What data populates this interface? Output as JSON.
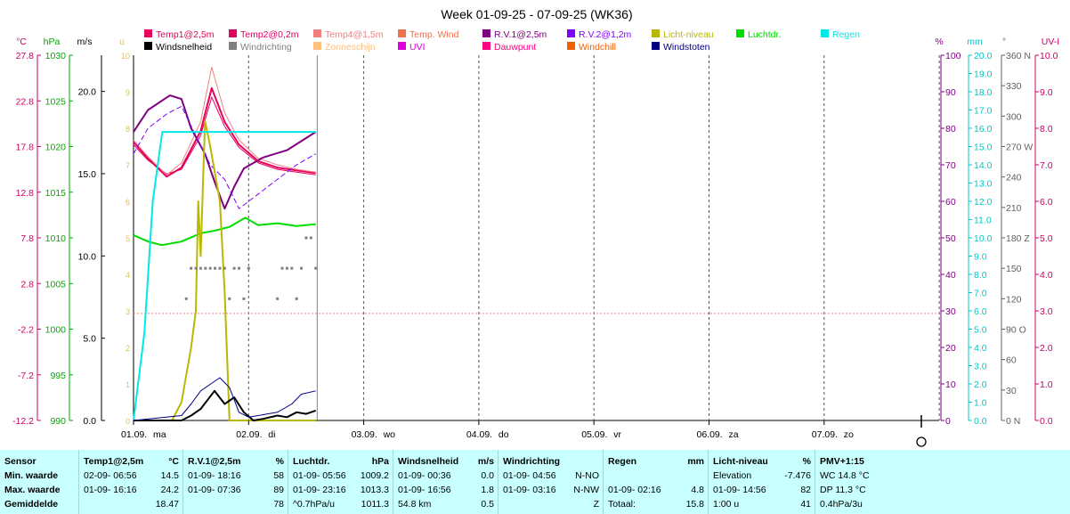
{
  "chart_data": {
    "type": "line",
    "title": "Week 01-09-25 - 07-09-25 (WK36)",
    "x_ticks": [
      {
        "date": "01.09.",
        "day": "ma"
      },
      {
        "date": "02.09.",
        "day": "di"
      },
      {
        "date": "03.09.",
        "day": "wo"
      },
      {
        "date": "04.09.",
        "day": "do"
      },
      {
        "date": "05.09.",
        "day": "vr"
      },
      {
        "date": "06.09.",
        "day": "za"
      },
      {
        "date": "07.09.",
        "day": "zo"
      }
    ],
    "axes": {
      "celsius": {
        "label": "°C",
        "ticks": [
          "27.8",
          "22.8",
          "17.8",
          "12.8",
          "7.8",
          "2.8",
          "-2.2",
          "-7.2",
          "-12.2"
        ],
        "color": "#cc0066"
      },
      "hpa": {
        "label": "hPa",
        "ticks": [
          "1030",
          "1025",
          "1020",
          "1015",
          "1010",
          "1005",
          "1000",
          "995",
          "990"
        ],
        "color": "#00aa00"
      },
      "ms": {
        "label": "m/s",
        "ticks": [
          "20.0",
          "15.0",
          "10.0",
          "5.0",
          "0.0"
        ],
        "color": "#000000"
      },
      "u": {
        "label": "u",
        "ticks": [
          "10",
          "9",
          "8",
          "7",
          "6",
          "5",
          "4",
          "3",
          "2",
          "1",
          "0"
        ],
        "color": "#e0c060"
      },
      "pct": {
        "label": "%",
        "ticks": [
          "100",
          "90",
          "80",
          "70",
          "60",
          "50",
          "40",
          "30",
          "20",
          "10",
          "0"
        ],
        "color": "#800080"
      },
      "mm": {
        "label": "mm",
        "ticks": [
          "20.0",
          "19.0",
          "18.0",
          "17.0",
          "16.0",
          "15.0",
          "14.0",
          "13.0",
          "12.0",
          "11.0",
          "10.0",
          "9.0",
          "8.0",
          "7.0",
          "6.0",
          "5.0",
          "4.0",
          "3.0",
          "2.0",
          "1.0",
          "0.0"
        ],
        "color": "#00c8c8"
      },
      "deg": {
        "label": "°",
        "ticks": [
          "360 N",
          "330",
          "300",
          "270 W",
          "240",
          "210",
          "180 Z",
          "150",
          "120",
          "90  O",
          "60",
          "30",
          "0    N"
        ],
        "color": "#606060"
      },
      "uvi": {
        "label": "UV-I",
        "ticks": [
          "10.0",
          "9.0",
          "8.0",
          "7.0",
          "6.0",
          "5.0",
          "4.0",
          "3.0",
          "2.0",
          "1.0",
          "0.0"
        ],
        "color": "#cc0066"
      }
    },
    "legend": [
      {
        "name": "Temp1@2,5m",
        "color": "#e8005a"
      },
      {
        "name": "Temp2@0,2m",
        "color": "#e00060"
      },
      {
        "name": "Temp4@1,5m",
        "color": "#f08080"
      },
      {
        "name": "Temp. Wind",
        "color": "#f07050"
      },
      {
        "name": "R.V.1@2,5m",
        "color": "#800080"
      },
      {
        "name": "R.V.2@1,2m",
        "color": "#8000ff"
      },
      {
        "name": "Licht-niveau",
        "color": "#b8b800"
      },
      {
        "name": "Luchtdr.",
        "color": "#00dd00"
      },
      {
        "name": "Regen",
        "color": "#00e8e8"
      },
      {
        "name": "Windsnelheid",
        "color": "#000000"
      },
      {
        "name": "Windrichting",
        "color": "#808080"
      },
      {
        "name": "Zonneschijn",
        "color": "#ffc080"
      },
      {
        "name": "UVI",
        "color": "#e000e0"
      },
      {
        "name": "Dauwpunt",
        "color": "#ff0080"
      },
      {
        "name": "Windchill",
        "color": "#f06000"
      },
      {
        "name": "Windstoten",
        "color": "#000080"
      }
    ],
    "series": [
      {
        "name": "Temp1@2,5m",
        "unit": "°C",
        "x_hours": [
          0,
          3,
          6.9,
          10,
          14,
          16.3,
          19,
          22,
          26,
          30,
          34,
          38
        ],
        "values": [
          18.3,
          16.5,
          14.5,
          15.5,
          19.5,
          24.2,
          20.5,
          18,
          16.2,
          15.5,
          15.2,
          14.9
        ]
      },
      {
        "name": "Temp2@0,2m",
        "unit": "°C",
        "x_hours": [
          0,
          3,
          6.9,
          10,
          14,
          16.3,
          19,
          22,
          26,
          30,
          34,
          38
        ],
        "values": [
          18,
          16.3,
          14.8,
          15.3,
          19,
          23.2,
          20,
          17.7,
          16,
          15.3,
          15,
          14.7
        ]
      },
      {
        "name": "Temp4@1,5m",
        "unit": "°C",
        "x_hours": [
          0,
          3,
          6.9,
          10,
          14,
          16.3,
          19,
          22,
          26,
          30,
          34,
          38
        ],
        "values": [
          18.5,
          16.7,
          14.7,
          16,
          20.5,
          26.5,
          21.5,
          18.5,
          16.5,
          15.8,
          15.3,
          15
        ]
      },
      {
        "name": "R.V.1@2,5m",
        "unit": "%",
        "x_hours": [
          0,
          3,
          7.6,
          10,
          12,
          14.9,
          17,
          19,
          21,
          23,
          27,
          32,
          38
        ],
        "values": [
          79,
          85,
          89,
          88,
          80,
          73,
          65,
          58,
          64,
          69,
          72,
          74,
          79
        ]
      },
      {
        "name": "R.V.2@1,2m",
        "unit": "%",
        "x_hours": [
          0,
          3,
          7,
          10,
          13,
          16,
          19,
          22,
          26,
          30,
          34,
          38
        ],
        "values": [
          73,
          80,
          84,
          86,
          78,
          70,
          66,
          58,
          62,
          66,
          70,
          73
        ]
      },
      {
        "name": "Luchtdr.",
        "unit": "hPa",
        "x_hours": [
          0,
          3,
          5.9,
          10,
          14,
          17,
          20,
          23.3,
          26,
          30,
          34,
          38
        ],
        "values": [
          1010.3,
          1009.6,
          1009.2,
          1009.6,
          1010.5,
          1010.8,
          1011.2,
          1012.2,
          1011.4,
          1011.6,
          1011.3,
          1011.5
        ]
      },
      {
        "name": "Licht-niveau",
        "unit": "%",
        "x_hours": [
          0,
          6,
          8,
          10,
          12,
          13,
          13.5,
          14,
          14.9,
          16,
          18,
          19,
          20,
          22,
          24,
          38
        ],
        "values": [
          0,
          0,
          0,
          5,
          20,
          30,
          60,
          45,
          82,
          75,
          60,
          35,
          0,
          0,
          0,
          0
        ]
      },
      {
        "name": "Regen",
        "unit": "mm",
        "x_hours": [
          0,
          2.27,
          4,
          6,
          8,
          38
        ],
        "values": [
          0,
          4.8,
          12,
          15.8,
          15.8,
          15.8
        ]
      },
      {
        "name": "Windsnelheid",
        "unit": "m/s",
        "x_hours": [
          0,
          10,
          12,
          14,
          16.9,
          19,
          21,
          23,
          25,
          27,
          30,
          32,
          34,
          36,
          38
        ],
        "values": [
          0,
          0,
          0.3,
          0.7,
          1.8,
          1.0,
          1.4,
          0.5,
          0,
          0.1,
          0.3,
          0.2,
          0.5,
          0.4,
          0.6
        ]
      },
      {
        "name": "Windstoten",
        "unit": "m/s",
        "x_hours": [
          0,
          10,
          12,
          14,
          16,
          18,
          20,
          22,
          24,
          26,
          30,
          33,
          35,
          38
        ],
        "values": [
          0,
          0.3,
          1.0,
          1.8,
          2.2,
          2.6,
          2.0,
          0.5,
          0.2,
          0.3,
          0.5,
          1.0,
          1.6,
          1.8
        ]
      },
      {
        "name": "Windrichting",
        "unit": "°",
        "x_hours": [
          11,
          12,
          13,
          14,
          15,
          16,
          17,
          18,
          19,
          20,
          21,
          22,
          23,
          24,
          30,
          31,
          32,
          33,
          34,
          35,
          36,
          37,
          38
        ],
        "values": [
          120,
          150,
          150,
          150,
          150,
          150,
          150,
          150,
          150,
          120,
          150,
          150,
          120,
          150,
          120,
          150,
          150,
          150,
          120,
          150,
          180,
          180,
          150
        ]
      }
    ],
    "ref_line": {
      "axis": "pct",
      "value": 29.3,
      "color": "#f08080"
    }
  },
  "stats": {
    "columns": [
      {
        "header": "Sensor",
        "unit": "",
        "rows": [
          {
            "label": "Min. waarde"
          },
          {
            "label": "Max. waarde"
          },
          {
            "label": "Gemiddelde"
          }
        ]
      },
      {
        "header": "Temp1@2,5m",
        "unit": "°C",
        "rows": [
          {
            "time": "02-09-  06:56",
            "val": "14.5"
          },
          {
            "time": "01-09-  16:16",
            "val": "24.2"
          },
          {
            "time": "",
            "val": "18.47"
          }
        ]
      },
      {
        "header": "R.V.1@2,5m",
        "unit": "%",
        "rows": [
          {
            "time": "01-09-  18:16",
            "val": "58"
          },
          {
            "time": "01-09-  07:36",
            "val": "89"
          },
          {
            "time": "",
            "val": "78"
          }
        ]
      },
      {
        "header": "Luchtdr.",
        "unit": "hPa",
        "rows": [
          {
            "time": "01-09-  05:56",
            "val": "1009.2"
          },
          {
            "time": "01-09-  23:16",
            "val": "1013.3"
          },
          {
            "time": "^0.7hPa/u",
            "val": "1011.3"
          }
        ]
      },
      {
        "header": "Windsnelheid",
        "unit": "m/s",
        "rows": [
          {
            "time": "01-09-  00:36",
            "val": "0.0"
          },
          {
            "time": "01-09-  16:56",
            "val": "1.8"
          },
          {
            "time": "54.8 km",
            "val": "0.5"
          }
        ]
      },
      {
        "header": "Windrichting",
        "unit": "",
        "rows": [
          {
            "time": "01-09-  04:56",
            "val": "N-NO"
          },
          {
            "time": "01-09-  03:16",
            "val": "N-NW"
          },
          {
            "time": "",
            "val": "Z"
          }
        ]
      },
      {
        "header": "Regen",
        "unit": "mm",
        "rows": [
          {
            "time": "",
            "val": ""
          },
          {
            "time": "01-09-  02:16",
            "val": "4.8"
          },
          {
            "time": "Totaal:",
            "val": "15.8"
          }
        ]
      },
      {
        "header": "Licht-niveau",
        "unit": "%",
        "rows": [
          {
            "time": "Elevation",
            "val": "-7.476"
          },
          {
            "time": "01-09-  14:56",
            "val": "82"
          },
          {
            "time": "1:00 u",
            "val": "41"
          }
        ]
      },
      {
        "header": "PMV+1:15",
        "unit": "",
        "rows": [
          {
            "time": "WC 14.8 °C",
            "val": ""
          },
          {
            "time": "DP 11.3 °C",
            "val": ""
          },
          {
            "time": "0.4hPa/3u",
            "val": ""
          }
        ]
      }
    ]
  },
  "clock_icon": "clock-icon"
}
